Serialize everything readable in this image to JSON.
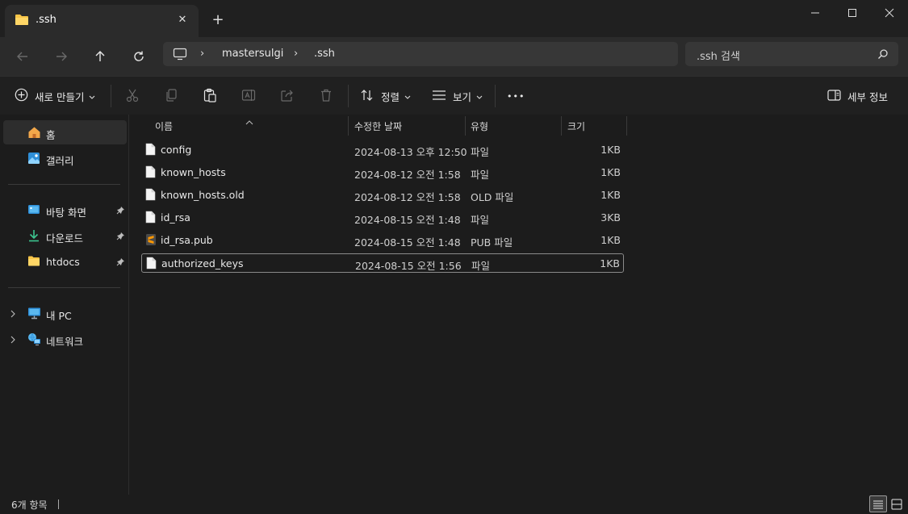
{
  "tab": {
    "title": ".ssh",
    "close_label": "✕",
    "new_tab_label": "+"
  },
  "window": {
    "minimize": "—",
    "maximize": "☐",
    "close": "✕"
  },
  "address": {
    "crumbs": [
      "mastersulgi",
      ".ssh"
    ],
    "separator": "›"
  },
  "search": {
    "placeholder": ".ssh 검색"
  },
  "toolbar": {
    "new_label": "새로 만들기",
    "sort_label": "정렬",
    "view_label": "보기",
    "more_label": "•••",
    "details_label": "세부 정보"
  },
  "sidebar": {
    "items": [
      {
        "label": "홈",
        "icon": "home-icon"
      },
      {
        "label": "갤러리",
        "icon": "gallery-icon"
      },
      {
        "label": "바탕 화면",
        "icon": "desktop-icon"
      },
      {
        "label": "다운로드",
        "icon": "download-icon"
      },
      {
        "label": "htdocs",
        "icon": "folder-icon"
      },
      {
        "label": "내 PC",
        "icon": "this-pc-icon"
      },
      {
        "label": "네트워크",
        "icon": "network-icon"
      }
    ]
  },
  "columns": {
    "name": "이름",
    "date": "수정한 날짜",
    "type": "유형",
    "size": "크기"
  },
  "files": [
    {
      "name": "config",
      "date": "2024-08-13 오후 12:50",
      "type": "파일",
      "size": "1KB",
      "icon": "file-icon"
    },
    {
      "name": "known_hosts",
      "date": "2024-08-12 오전 1:58",
      "type": "파일",
      "size": "1KB",
      "icon": "file-icon"
    },
    {
      "name": "known_hosts.old",
      "date": "2024-08-12 오전 1:58",
      "type": "OLD 파일",
      "size": "1KB",
      "icon": "file-icon"
    },
    {
      "name": "id_rsa",
      "date": "2024-08-15 오전 1:48",
      "type": "파일",
      "size": "3KB",
      "icon": "file-icon"
    },
    {
      "name": "id_rsa.pub",
      "date": "2024-08-15 오전 1:48",
      "type": "PUB 파일",
      "size": "1KB",
      "icon": "sublime-file-icon"
    },
    {
      "name": "authorized_keys",
      "date": "2024-08-15 오전 1:56",
      "type": "파일",
      "size": "1KB",
      "icon": "file-icon"
    }
  ],
  "status": {
    "count": "6개 항목"
  },
  "colors": {
    "accent": "#4cc2ff",
    "folder": "#f8c548",
    "background": "#1c1c1c"
  }
}
